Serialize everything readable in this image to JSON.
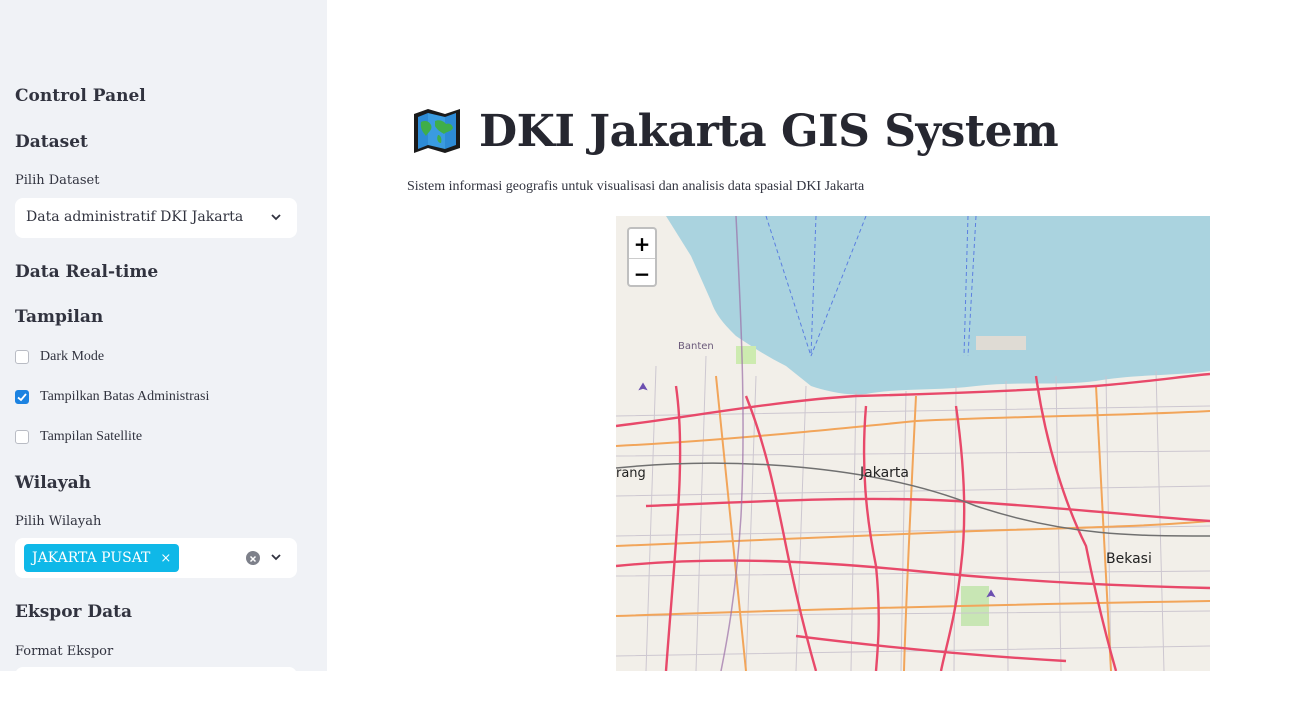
{
  "sidebar": {
    "title": "Control Panel",
    "dataset": {
      "heading": "Dataset",
      "label": "Pilih Dataset",
      "selected": "Data administratif DKI Jakarta"
    },
    "realtime": {
      "heading": "Data Real-time"
    },
    "display": {
      "heading": "Tampilan",
      "options": [
        {
          "label": "Dark Mode",
          "checked": false
        },
        {
          "label": "Tampilkan Batas Administrasi",
          "checked": true
        },
        {
          "label": "Tampilan Satellite",
          "checked": false
        }
      ]
    },
    "region": {
      "heading": "Wilayah",
      "label": "Pilih Wilayah",
      "selected_tag": "JAKARTA PUSAT",
      "tag_remove": "×"
    },
    "export": {
      "heading": "Ekspor Data",
      "label": "Format Ekspor"
    }
  },
  "main": {
    "title": "DKI Jakarta GIS System",
    "icon": "world-map-icon",
    "subtitle": "Sistem informasi geografis untuk visualisasi dan analisis data spasial DKI Jakarta"
  },
  "map": {
    "zoom_in": "+",
    "zoom_out": "−",
    "place_labels": {
      "jakarta": "Jakarta",
      "bekasi": "Bekasi",
      "banten": "Banten",
      "tangerang": "rang"
    },
    "colors": {
      "sea": "#aad3df",
      "land": "#f2efe9",
      "primary_road": "#e8496a",
      "secondary_road": "#f2a55a"
    }
  }
}
